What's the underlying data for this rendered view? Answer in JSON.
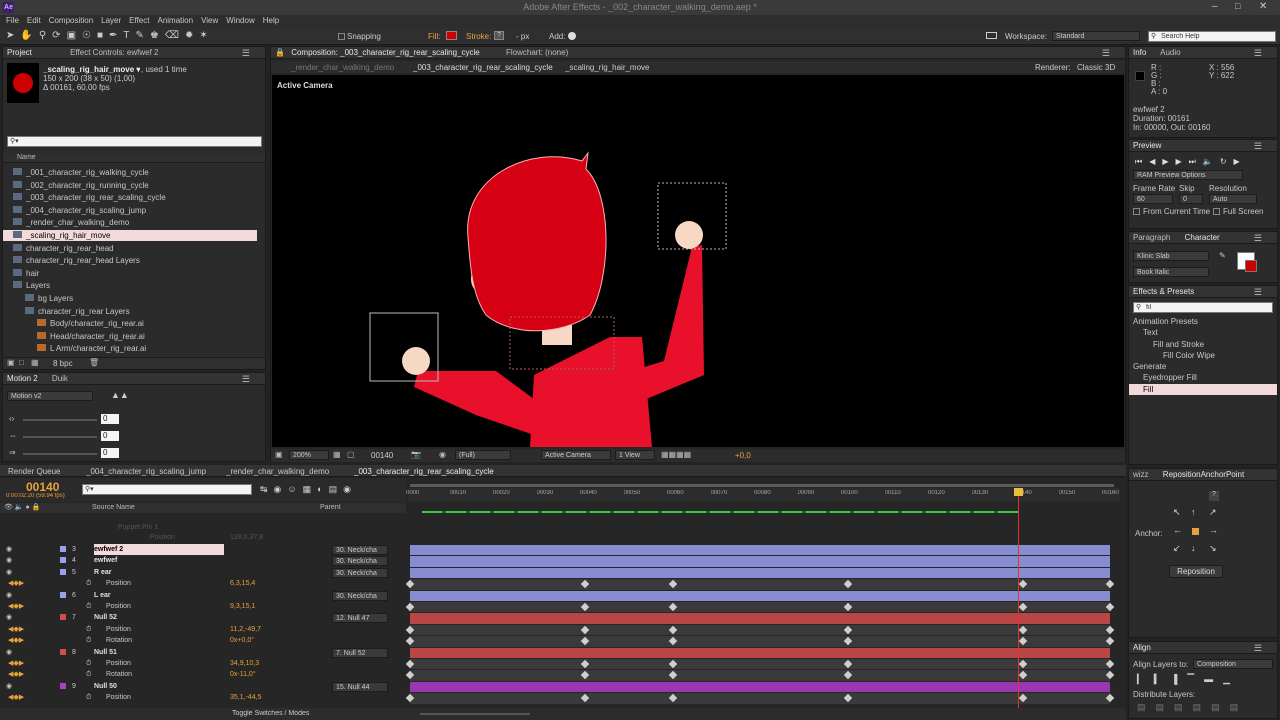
{
  "window_title": "Adobe After Effects - _002_character_walking_demo.aep *",
  "menu": [
    "File",
    "Edit",
    "Composition",
    "Layer",
    "Effect",
    "Animation",
    "View",
    "Window",
    "Help"
  ],
  "toolbar": {
    "snapping": "Snapping",
    "fill": "Fill:",
    "stroke": "Stroke:",
    "px": "- px",
    "add": "Add:",
    "workspace_label": "Workspace:",
    "workspace_value": "Standard",
    "search_placeholder": "Search Help"
  },
  "project": {
    "tabs": [
      "Project",
      "Effect Controls: ewfwef 2"
    ],
    "item_name": "_scaling_rig_hair_move ▾",
    "used": ", used 1 time",
    "dims": "150 x 200 (38 x 50) (1,00)",
    "duration": "Δ 00161, 60,00 fps",
    "col_name": "Name",
    "items": [
      {
        "label": "_001_character_rig_walking_cycle",
        "indent": 0
      },
      {
        "label": "_002_character_rig_running_cycle",
        "indent": 0
      },
      {
        "label": "_003_character_rig_rear_scaling_cycle",
        "indent": 0
      },
      {
        "label": "_004_character_rig_scaling_jump",
        "indent": 0
      },
      {
        "label": "_render_char_walking_demo",
        "indent": 0
      },
      {
        "label": "_scaling_rig_hair_move",
        "indent": 0,
        "selected": true
      },
      {
        "label": "character_rig_rear_head",
        "indent": 0
      },
      {
        "label": "character_rig_rear_head Layers",
        "indent": 0
      },
      {
        "label": "hair",
        "indent": 0
      },
      {
        "label": "Layers",
        "indent": 0
      },
      {
        "label": "bg Layers",
        "indent": 1
      },
      {
        "label": "character_rig_rear Layers",
        "indent": 1
      },
      {
        "label": "Body/character_rig_rear.ai",
        "indent": 2
      },
      {
        "label": "Head/character_rig_rear.ai",
        "indent": 2
      },
      {
        "label": "L Arm/character_rig_rear.ai",
        "indent": 2
      }
    ],
    "bpc": "8 bpc"
  },
  "motion": {
    "tabs": [
      "Motion 2",
      "Duik"
    ],
    "dropdown": "Motion v2",
    "values": [
      "0",
      "0",
      "0"
    ]
  },
  "comp": {
    "tabs": [
      "Composition: _003_character_rig_rear_scaling_cycle",
      "Flowchart: (none)"
    ],
    "subtabs": [
      "_render_char_walking_demo",
      "_003_character_rig_rear_scaling_cycle",
      "_scaling_rig_hair_move"
    ],
    "renderer_label": "Renderer:",
    "renderer": "Classic 3D",
    "camera_label": "Active Camera",
    "zoom": "200%",
    "time": "00140",
    "quality": "(Full)",
    "camera": "Active Camera",
    "views": "1 View",
    "exposure": "+0,0"
  },
  "info": {
    "tabs": [
      "Info",
      "Audio"
    ],
    "rgba": [
      "R :",
      "G :",
      "B :",
      "A : 0"
    ],
    "x": "X : 556",
    "y": "Y : 622",
    "name": "ewfwef 2",
    "duration": "Duration: 00161",
    "inout": "In: 00000, Out: 00160"
  },
  "preview": {
    "tab": "Preview",
    "ram": "RAM Preview Options",
    "frame_rate_label": "Frame Rate",
    "skip_label": "Skip",
    "resolution_label": "Resolution",
    "frame_rate": "60",
    "skip": "0",
    "resolution": "Auto",
    "from_current": "From Current Time",
    "full_screen": "Full Screen"
  },
  "character": {
    "tabs": [
      "Paragraph",
      "Character"
    ],
    "font": "Klinic Slab",
    "style": "Book Italic"
  },
  "effects": {
    "tab": "Effects & Presets",
    "search": "fil",
    "items": [
      {
        "label": "Animation Presets",
        "indent": 0
      },
      {
        "label": "Text",
        "indent": 1
      },
      {
        "label": "Fill and Stroke",
        "indent": 2
      },
      {
        "label": "Fill Color Wipe",
        "indent": 3
      },
      {
        "label": "Generate",
        "indent": 0
      },
      {
        "label": "Eyedropper Fill",
        "indent": 1
      },
      {
        "label": "Fill",
        "indent": 1,
        "selected": true
      }
    ]
  },
  "timeline_tabs": [
    "Render Queue",
    "_004_character_rig_scaling_jump",
    "_render_char_walking_demo",
    "_003_character_rig_rear_scaling_cycle"
  ],
  "timeline": {
    "timecode": "00140",
    "fps": "0:00:02:20 (59.94 fps)",
    "col_source": "Source Name",
    "col_parent": "Parent",
    "ruler": [
      "0000",
      "00010",
      "00020",
      "00030",
      "00040",
      "00050",
      "00060",
      "00070",
      "00080",
      "00090",
      "00100",
      "00110",
      "00120",
      "00130",
      "00140",
      "00150",
      "00160"
    ],
    "faded": [
      "Puppet Pin 1",
      "Position",
      "128,0,37,8"
    ],
    "layers": [
      {
        "num": "3",
        "name": "ewfwef 2",
        "type": "layer",
        "parent": "30. Neck/cha",
        "color": "#9aa0f0",
        "selected": true
      },
      {
        "num": "4",
        "name": "ewfwef",
        "type": "layer",
        "parent": "30. Neck/cha",
        "color": "#9aa0f0"
      },
      {
        "num": "5",
        "name": "R ear",
        "type": "layer",
        "parent": "30. Neck/cha",
        "color": "#9aa0f0"
      },
      {
        "name": "Position",
        "type": "prop",
        "value": "6,3,15,4"
      },
      {
        "num": "6",
        "name": "L ear",
        "type": "layer",
        "parent": "30. Neck/cha",
        "color": "#9aa0f0"
      },
      {
        "name": "Position",
        "type": "prop",
        "value": "9,3,15,1"
      },
      {
        "num": "7",
        "name": "Null 52",
        "type": "layer",
        "parent": "12. Null 47",
        "color": "#d44c4c"
      },
      {
        "name": "Position",
        "type": "prop",
        "value": "11,2,-49,7"
      },
      {
        "name": "Rotation",
        "type": "prop",
        "value": "0x+0,0°"
      },
      {
        "num": "8",
        "name": "Null 51",
        "type": "layer",
        "parent": "7. Null 52",
        "color": "#d44c4c"
      },
      {
        "name": "Position",
        "type": "prop",
        "value": "34,9,10,3"
      },
      {
        "name": "Rotation",
        "type": "prop",
        "value": "0x-11,0°"
      },
      {
        "num": "9",
        "name": "Null 50",
        "type": "layer",
        "parent": "15. Null 44",
        "color": "#b03cc8"
      },
      {
        "name": "Position",
        "type": "prop",
        "value": "35,1,-44,5"
      }
    ],
    "toggle": "Toggle Switches / Modes"
  },
  "wizz": {
    "tabs": [
      "wizz",
      "RepositionAnchorPoint"
    ],
    "anchor": "Anchor:",
    "reposition": "Reposition"
  },
  "align": {
    "tab": "Align",
    "align_to_label": "Align Layers to:",
    "align_to": "Composition",
    "distribute": "Distribute Layers:"
  }
}
